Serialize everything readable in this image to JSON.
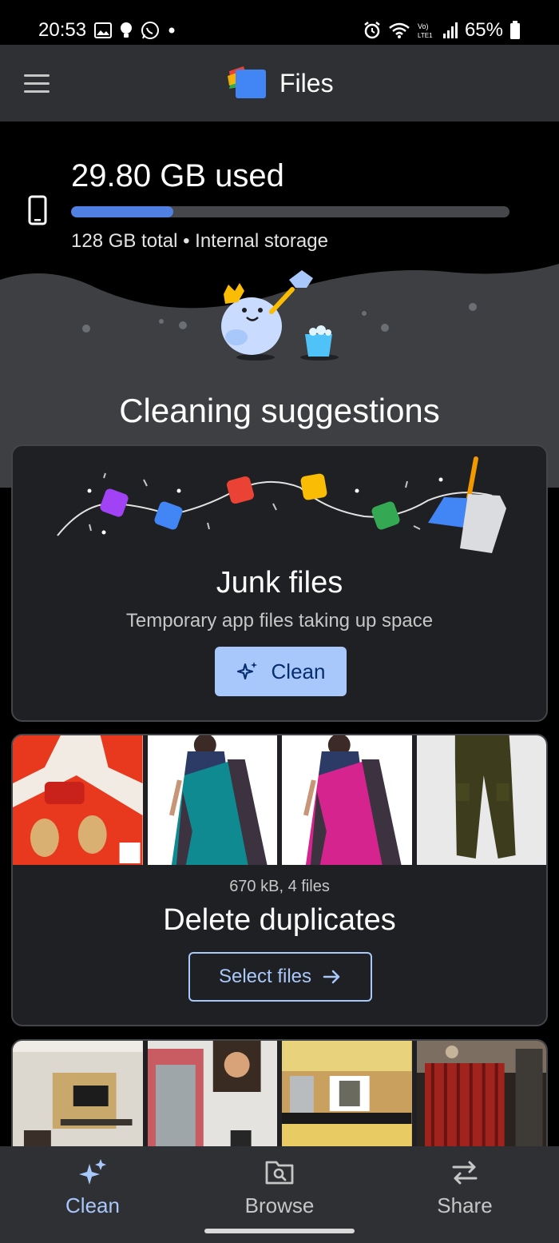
{
  "status_bar": {
    "time": "20:53",
    "battery": "65%",
    "left_icons": [
      "gallery-icon",
      "bulb-icon",
      "whatsapp-icon",
      "dot-icon"
    ],
    "right_icons": [
      "alarm-icon",
      "wifi-icon",
      "volte-icon",
      "signal-icon",
      "battery-icon"
    ]
  },
  "app_bar": {
    "title": "Files",
    "menu_icon": "hamburger-menu-icon",
    "logo_icon": "files-logo-icon"
  },
  "storage": {
    "used_label": "29.80 GB used",
    "used_fraction": 0.233,
    "subtitle": "128 GB total • Internal storage",
    "icon": "phone-icon"
  },
  "section_title": "Cleaning suggestions",
  "junk_card": {
    "title": "Junk files",
    "description": "Temporary app files taking up space",
    "button_label": "Clean",
    "button_icon": "sparkle-icon"
  },
  "duplicates_card": {
    "meta": "670 kB, 4 files",
    "title": "Delete duplicates",
    "button_label": "Select files",
    "button_icon": "arrow-right-icon",
    "thumbnails": [
      "red-saree-thumbnail",
      "teal-saree-thumbnail",
      "pink-saree-thumbnail",
      "olive-cargo-pants-thumbnail"
    ]
  },
  "third_card": {
    "thumbnails": [
      "living-room-thumbnail",
      "mirror-wardrobe-thumbnail",
      "kitchen-thumbnail",
      "curtain-room-thumbnail"
    ]
  },
  "bottom_nav": {
    "items": [
      {
        "label": "Clean",
        "icon": "sparkle-icon",
        "active": true
      },
      {
        "label": "Browse",
        "icon": "browse-folder-icon",
        "active": false
      },
      {
        "label": "Share",
        "icon": "share-arrows-icon",
        "active": false
      }
    ]
  },
  "colors": {
    "accent": "#a8c7fa",
    "storage_fill": "#4f80e2",
    "card_bg": "#1f2023",
    "bar_bg": "#2f3033"
  }
}
